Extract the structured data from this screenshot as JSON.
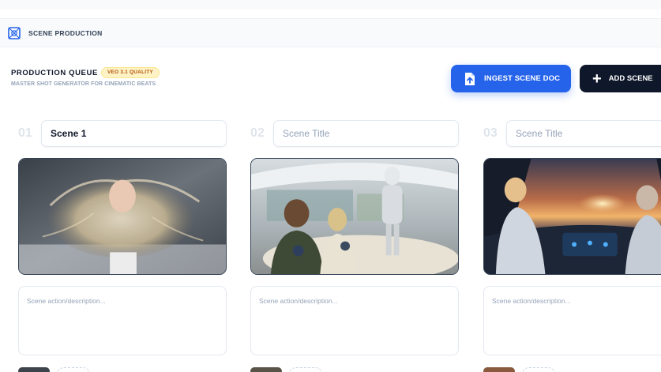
{
  "header": {
    "section_title": "SCENE PRODUCTION",
    "logo_icon": "film-grid-icon"
  },
  "queue": {
    "title": "PRODUCTION QUEUE",
    "badge": "VEO 3.1 QUALITY",
    "subtitle": "MASTER SHOT GENERATOR FOR CINEMATIC BEATS"
  },
  "actions": {
    "ingest_label": "INGEST SCENE DOC",
    "ingest_icon": "file-upload-icon",
    "add_label": "ADD SCENE",
    "add_icon": "plus-icon"
  },
  "scenes": [
    {
      "number": "01",
      "title_value": "Scene 1",
      "title_placeholder": "Scene Title",
      "description_placeholder": "Scene action/description...",
      "image": "woman-lying-on-bed"
    },
    {
      "number": "02",
      "title_value": "",
      "title_placeholder": "Scene Title",
      "description_placeholder": "Scene action/description...",
      "image": "people-dining-with-robot"
    },
    {
      "number": "03",
      "title_value": "",
      "title_placeholder": "Scene Title",
      "description_placeholder": "Scene action/description...",
      "image": "astronauts-in-cockpit-at-sunset"
    }
  ],
  "colors": {
    "accent_blue": "#2563eb",
    "dark_button": "#0f172a",
    "badge_bg": "#fef3c7",
    "badge_text": "#b45309"
  }
}
